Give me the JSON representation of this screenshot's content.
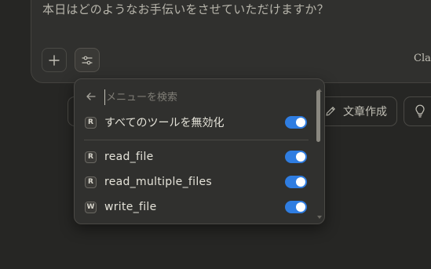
{
  "chat": {
    "prompt_text": "本日はどのようなお手伝いをさせていただけますか？",
    "model_label": "Cla"
  },
  "chips": {
    "write_label": "文章作成"
  },
  "menu": {
    "search_placeholder": "メニューを検索",
    "disable_all": {
      "icon_letter": "R",
      "label": "すべてのツールを無効化",
      "enabled": true
    },
    "tools": [
      {
        "icon_letter": "R",
        "label": "read_file",
        "enabled": true
      },
      {
        "icon_letter": "R",
        "label": "read_multiple_files",
        "enabled": true
      },
      {
        "icon_letter": "W",
        "label": "write_file",
        "enabled": true
      }
    ]
  },
  "colors": {
    "background": "#262624",
    "panel": "#30302e",
    "toggle_on": "#2f7de1"
  },
  "icons": [
    "plus-icon",
    "sliders-icon",
    "pencil-icon",
    "lightbulb-icon",
    "arrow-left-icon"
  ]
}
